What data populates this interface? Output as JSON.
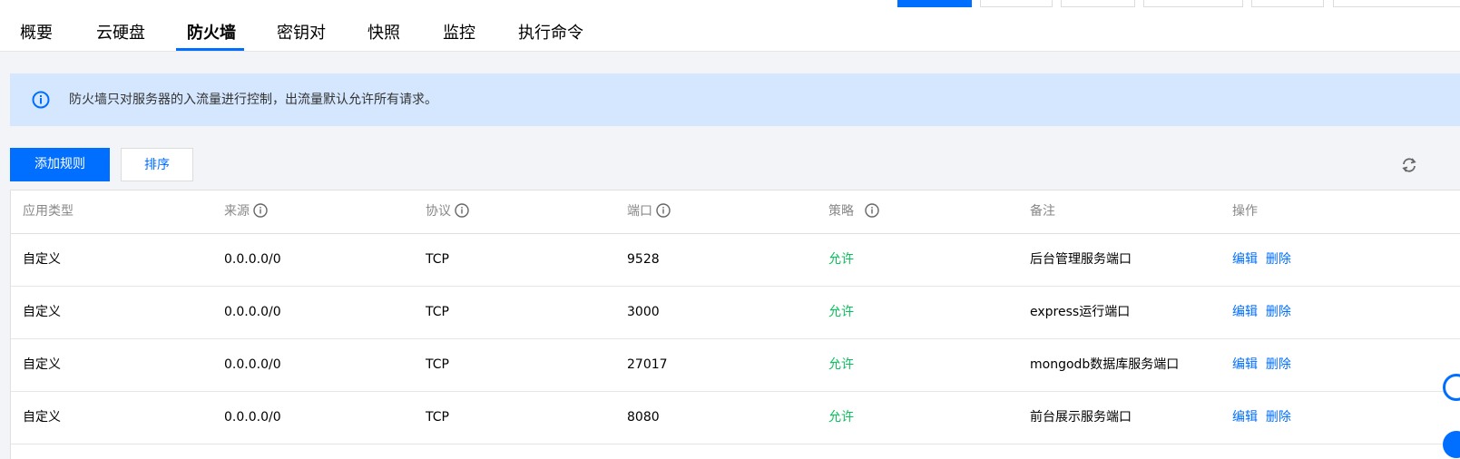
{
  "tabs": [
    {
      "label": "概要"
    },
    {
      "label": "云硬盘"
    },
    {
      "label": "防火墙",
      "active": true
    },
    {
      "label": "密钥对"
    },
    {
      "label": "快照"
    },
    {
      "label": "监控"
    },
    {
      "label": "执行命令"
    }
  ],
  "notice": {
    "icon": "info-icon",
    "text": "防火墙只对服务器的入流量进行控制，出流量默认允许所有请求。"
  },
  "toolbar": {
    "add_label": "添加规则",
    "sort_label": "排序",
    "refresh_icon": "refresh-icon"
  },
  "colors": {
    "accent": "#006eff",
    "allow": "#0abf5b",
    "notice_bg": "#d5e7ff",
    "page_bg": "#f3f4f7"
  },
  "table": {
    "columns": [
      {
        "label": "应用类型",
        "info": false
      },
      {
        "label": "来源",
        "info": true
      },
      {
        "label": "协议",
        "info": true
      },
      {
        "label": "端口",
        "info": true
      },
      {
        "label": "策略",
        "info": true
      },
      {
        "label": "备注",
        "info": false
      },
      {
        "label": "操作",
        "info": false
      }
    ],
    "rows": [
      {
        "type": "自定义",
        "source": "0.0.0.0/0",
        "protocol": "TCP",
        "port": "9528",
        "policy": "允许",
        "remark": "后台管理服务端口",
        "edit": "编辑",
        "delete": "删除"
      },
      {
        "type": "自定义",
        "source": "0.0.0.0/0",
        "protocol": "TCP",
        "port": "3000",
        "policy": "允许",
        "remark": "express运行端口",
        "edit": "编辑",
        "delete": "删除"
      },
      {
        "type": "自定义",
        "source": "0.0.0.0/0",
        "protocol": "TCP",
        "port": "27017",
        "policy": "允许",
        "remark": "mongodb数据库服务端口",
        "edit": "编辑",
        "delete": "删除"
      },
      {
        "type": "自定义",
        "source": "0.0.0.0/0",
        "protocol": "TCP",
        "port": "8080",
        "policy": "允许",
        "remark": "前台展示服务端口",
        "edit": "编辑",
        "delete": "删除"
      }
    ]
  }
}
